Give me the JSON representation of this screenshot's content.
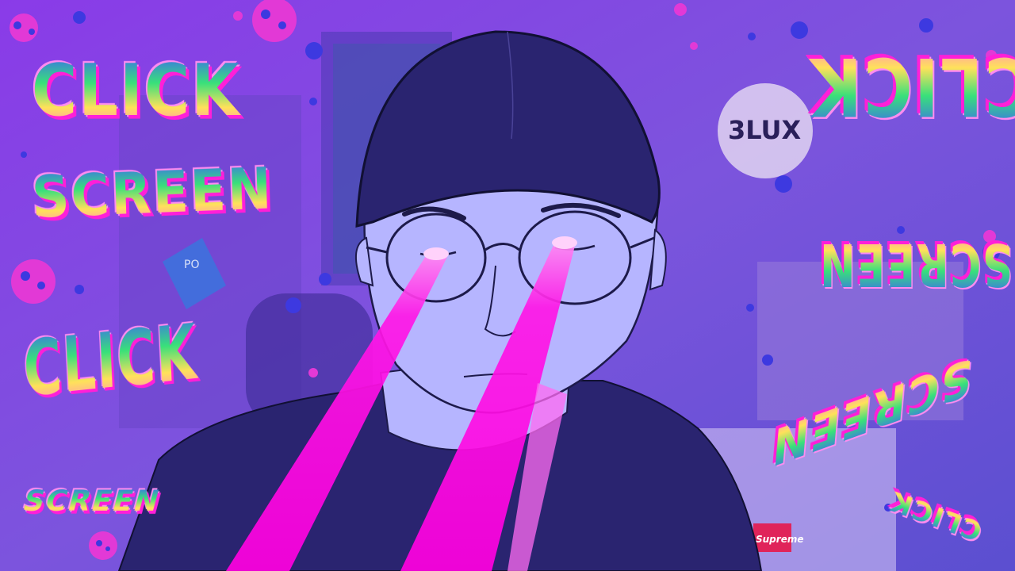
{
  "graffiti": {
    "click_1": "CLICK",
    "screen_1": "SCREEN",
    "click_2": "CLICK",
    "screen_2": "SCREEN",
    "click_3": "CLICK",
    "screen_3": "SCREEN",
    "screen_4": "SCREEN",
    "click_4": "CLICK"
  },
  "background_text": {
    "brand_logo": "Supreme",
    "wall_plate": "3LUX",
    "poster_text": "PO"
  },
  "colors": {
    "gradient_top": "#8a3be8",
    "gradient_bottom": "#5b4fd0",
    "laser": "#ff16e6",
    "face_fill": "#b6b5ff",
    "outline": "#1d1a4a",
    "dots": "#3d39e0",
    "pink_blob": "#e239d6"
  }
}
